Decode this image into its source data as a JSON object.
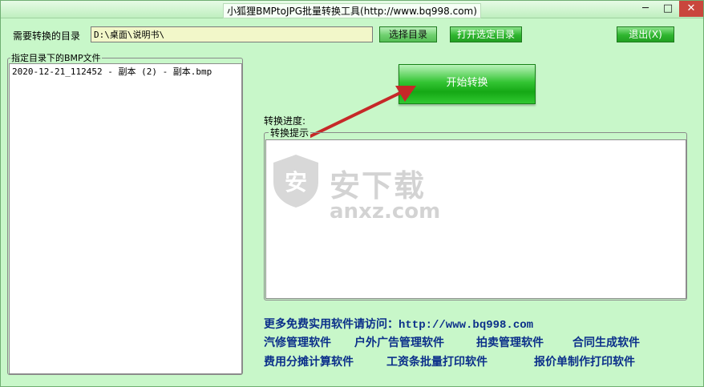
{
  "window": {
    "title": "小狐狸BMPtoJPG批量转换工具(http://www.bq998.com)",
    "minimize_glyph": "─",
    "maximize_glyph": "□",
    "close_glyph": "✕"
  },
  "directory": {
    "label": "需要转换的目录",
    "value": "D:\\桌面\\说明书\\"
  },
  "buttons": {
    "select_dir": "选择目录",
    "open_dir": "打开选定目录",
    "exit": "退出(X)",
    "start": "开始转换"
  },
  "file_group": {
    "legend": "指定目录下的BMP文件",
    "files": [
      "2020-12-21_112452 - 副本 (2) - 副本.bmp"
    ]
  },
  "progress": {
    "label": "转换进度:"
  },
  "tips_group": {
    "legend": "转换提示"
  },
  "watermark": {
    "text": "安下载",
    "sub": "anxz.com",
    "badge": "安"
  },
  "promo": {
    "visit_line": "更多免费实用软件请访问：http://www.bq998.com",
    "row1": [
      "汽修管理软件",
      "户外广告管理软件",
      "拍卖管理软件",
      "合同生成软件"
    ],
    "row2": [
      "费用分摊计算软件",
      "工资条批量打印软件",
      "报价单制作打印软件"
    ]
  },
  "colors": {
    "window_bg": "#c8f7c9",
    "button_green": "#2fb52f",
    "promo_text": "#0b2f8a",
    "arrow": "#c62828",
    "input_bg": "#f2f7c9"
  }
}
